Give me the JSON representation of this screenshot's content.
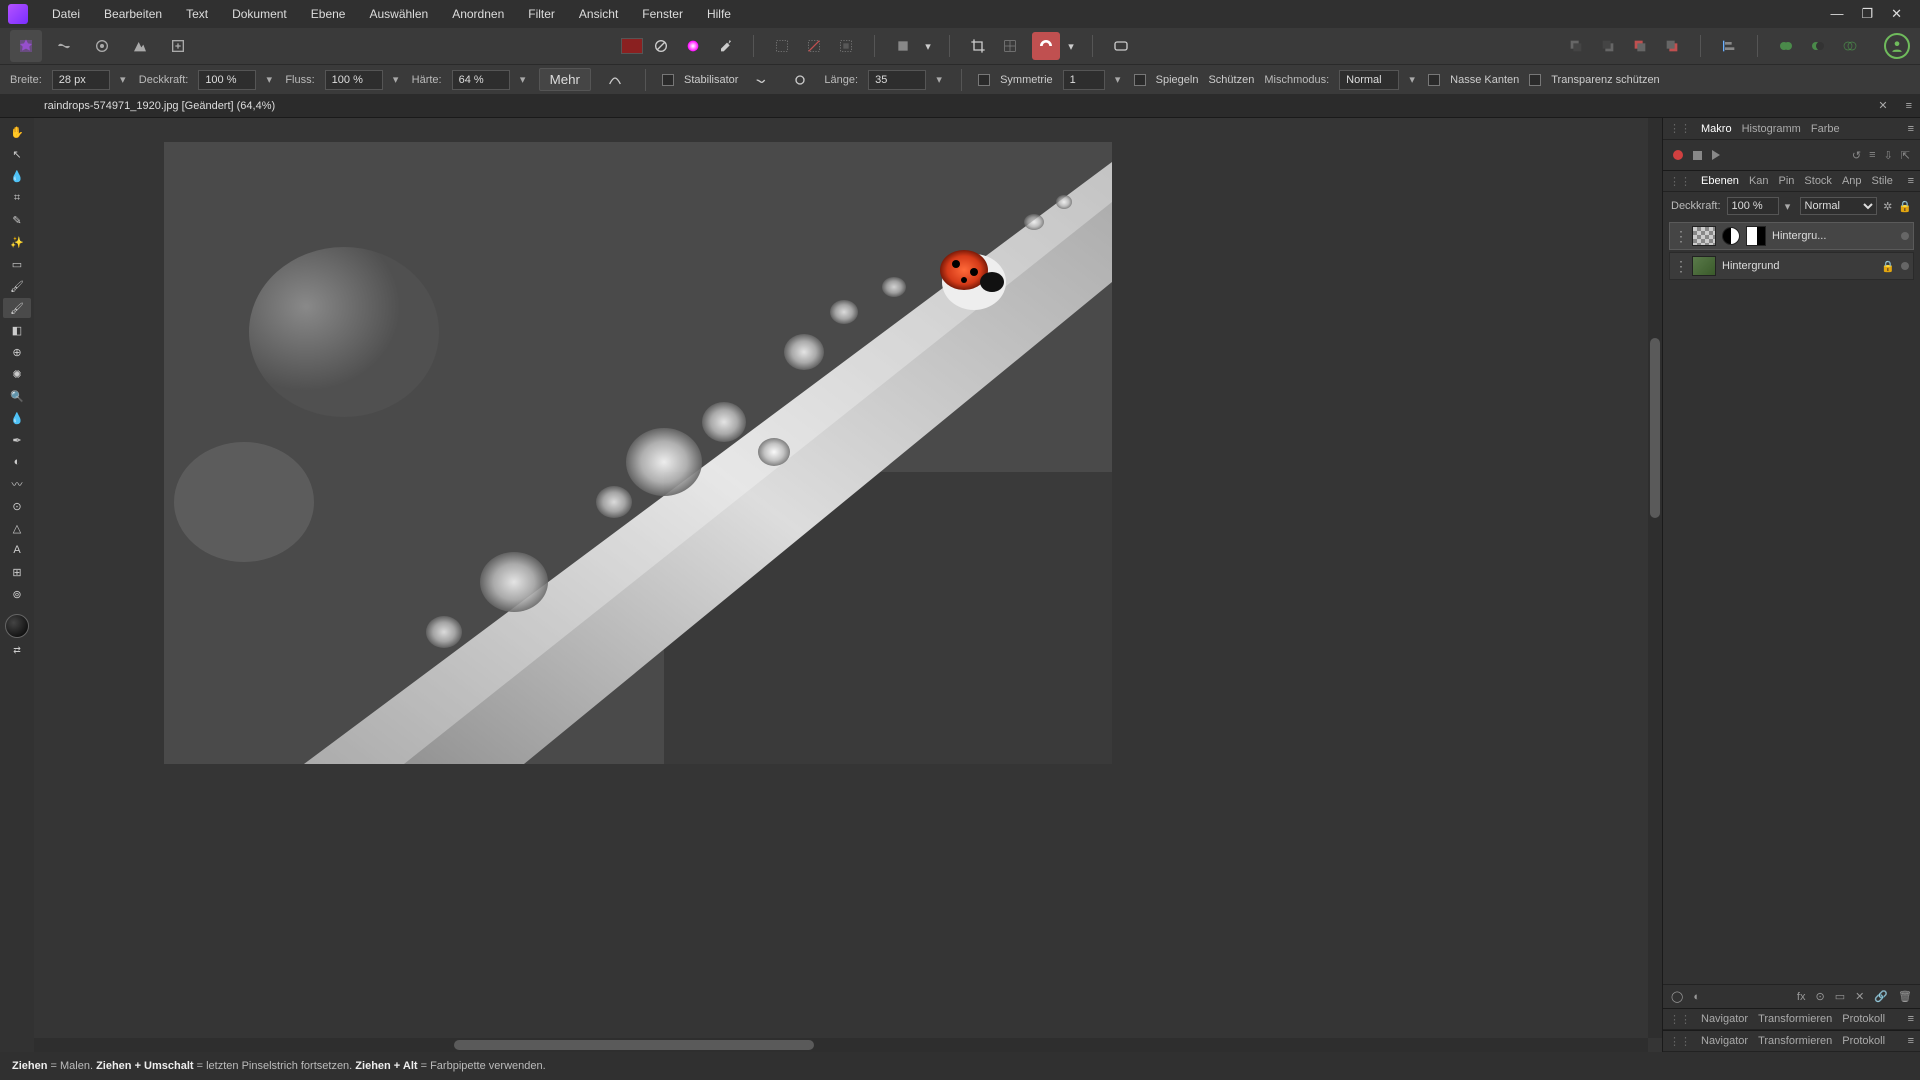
{
  "menu": [
    "Datei",
    "Bearbeiten",
    "Text",
    "Dokument",
    "Ebene",
    "Auswählen",
    "Anordnen",
    "Filter",
    "Ansicht",
    "Fenster",
    "Hilfe"
  ],
  "context": {
    "width_label": "Breite:",
    "width": "28 px",
    "opacity_label": "Deckkraft:",
    "opacity": "100 %",
    "flow_label": "Fluss:",
    "flow": "100 %",
    "hardness_label": "Härte:",
    "hardness": "64 %",
    "more": "Mehr",
    "stabilizer": "Stabilisator",
    "length_label": "Länge:",
    "length": "35",
    "symmetry": "Symmetrie",
    "symmetry_val": "1",
    "mirror": "Spiegeln",
    "protect": "Schützen",
    "blendmode_label": "Mischmodus:",
    "blendmode": "Normal",
    "wet": "Nasse Kanten",
    "alpha": "Transparenz schützen"
  },
  "document": {
    "title": "raindrops-574971_1920.jpg [Geändert] (64,4%)"
  },
  "panels": {
    "group1": [
      "Makro",
      "Histogramm",
      "Farbe"
    ],
    "group2": [
      "Ebenen",
      "Kan",
      "Pin",
      "Stock",
      "Anp",
      "Stile"
    ],
    "group3": [
      "Navigator",
      "Transformieren",
      "Protokoll"
    ],
    "group4": [
      "Navigator",
      "Transformieren",
      "Protokoll"
    ]
  },
  "layers": {
    "opacity_label": "Deckkraft:",
    "opacity": "100 %",
    "blend": "Normal",
    "items": [
      {
        "name": "Hintergru...",
        "adj": true,
        "locked": false
      },
      {
        "name": "Hintergrund",
        "adj": false,
        "locked": true
      }
    ]
  },
  "status": {
    "s1a": "Ziehen",
    "s1b": " = Malen. ",
    "s2a": "Ziehen + Umschalt",
    "s2b": " = letzten Pinselstrich fortsetzen. ",
    "s3a": "Ziehen + Alt",
    "s3b": " = Farbpipette verwenden."
  }
}
